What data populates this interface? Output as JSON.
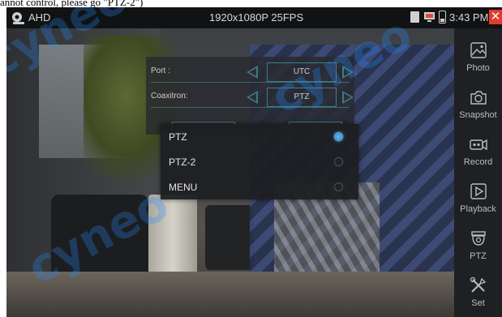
{
  "caption": "annot control, please go \"PTZ-2\")",
  "topbar": {
    "mode": "AHD",
    "resolution": "1920x1080P 25FPS",
    "time": "3:43 PM",
    "close_glyph": "✕"
  },
  "toolbar": [
    {
      "label": "Photo",
      "icon": "photo-icon"
    },
    {
      "label": "Snapshot",
      "icon": "camera-icon"
    },
    {
      "label": "Record",
      "icon": "video-camera-icon"
    },
    {
      "label": "Playback",
      "icon": "play-icon"
    },
    {
      "label": "PTZ",
      "icon": "dome-camera-icon"
    },
    {
      "label": "Set",
      "icon": "tools-icon"
    }
  ],
  "panel": {
    "rows": [
      {
        "label": "Port :",
        "value": "UTC"
      },
      {
        "label": "Coaxitron:",
        "value": "PTZ"
      }
    ]
  },
  "popup": {
    "options": [
      {
        "label": "PTZ",
        "selected": true
      },
      {
        "label": "PTZ-2",
        "selected": false
      },
      {
        "label": "MENU",
        "selected": false
      }
    ]
  },
  "watermark": [
    "cyneo",
    "cyneo",
    "cyneo"
  ],
  "colors": {
    "accent": "#3d7f8a",
    "radio_selected": "#3f95d6",
    "close": "#e23a2d"
  }
}
